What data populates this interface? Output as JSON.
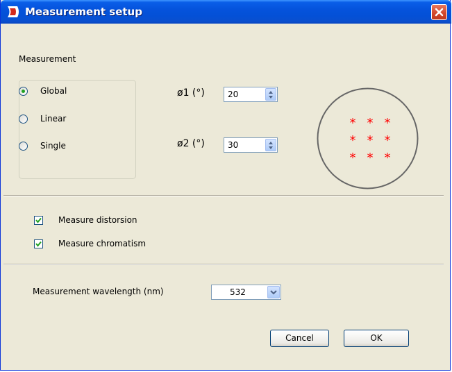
{
  "window": {
    "title": "Measurement setup",
    "icons": {
      "app": "app-logo-icon",
      "close": "close-icon"
    }
  },
  "measurement": {
    "section_label": "Measurement",
    "options": [
      {
        "label": "Global",
        "checked": true
      },
      {
        "label": "Linear",
        "checked": false
      },
      {
        "label": "Single",
        "checked": false
      }
    ],
    "phi1": {
      "label": "ø1 (°)",
      "value": "20"
    },
    "phi2": {
      "label": "ø2 (°)",
      "value": "30"
    },
    "preview": {
      "grid_rows": 3,
      "grid_cols": 3,
      "marker": "*",
      "marker_color": "#ff0000",
      "circle_color": "#666666"
    }
  },
  "checks": [
    {
      "label": "Measure distorsion",
      "checked": true
    },
    {
      "label": "Measure chromatism",
      "checked": true
    }
  ],
  "wavelength": {
    "label": "Measurement wavelength (nm)",
    "value": "532"
  },
  "buttons": {
    "cancel": "Cancel",
    "ok": "OK"
  },
  "colors": {
    "title_bar": "#0553dc",
    "dialog_bg": "#ece9d8",
    "check_green": "#21a121"
  }
}
